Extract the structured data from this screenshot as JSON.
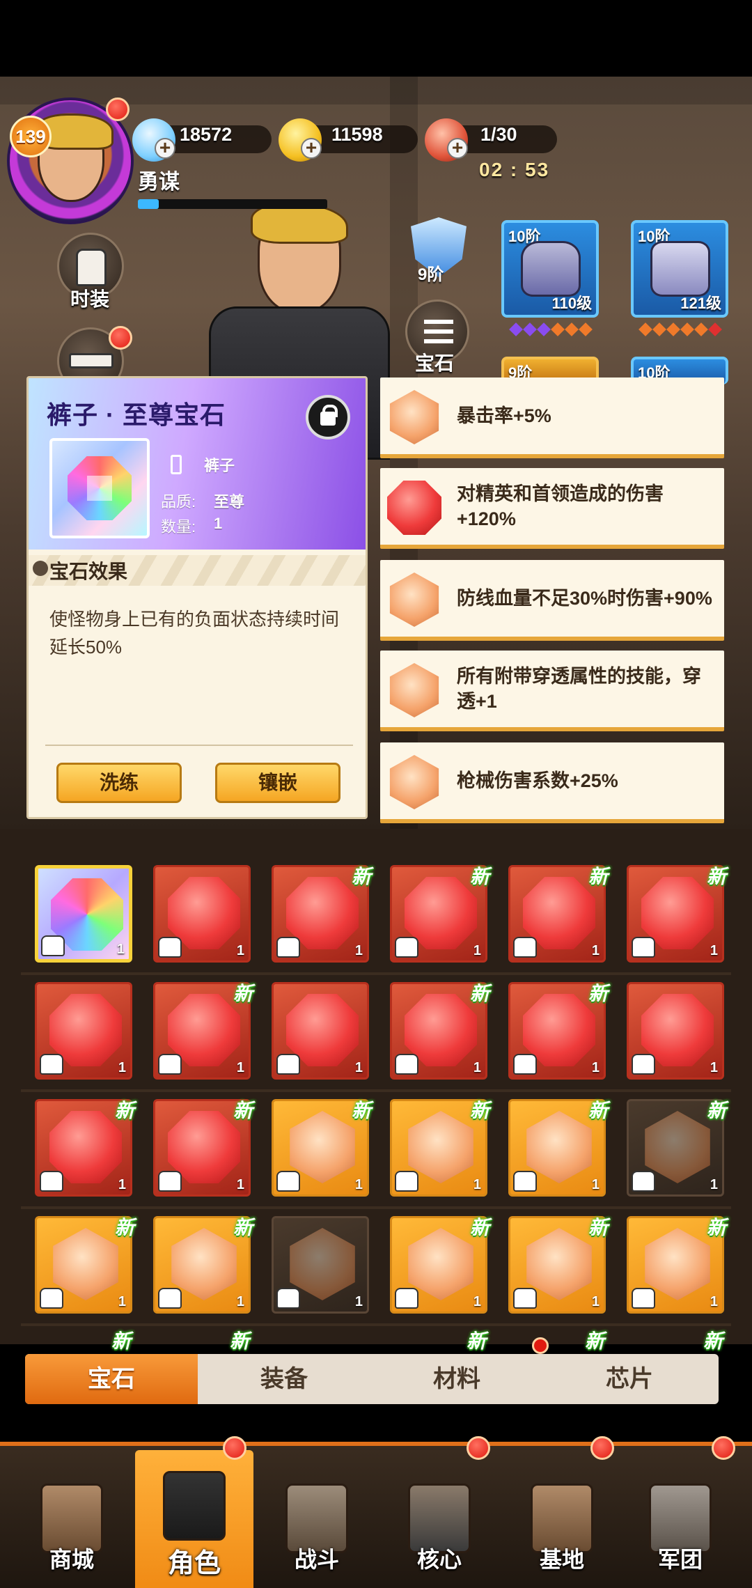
{
  "player": {
    "level": "139",
    "name": "勇谋",
    "timer": "02 : 53"
  },
  "resources": {
    "diamonds": "18572",
    "coins": "11598",
    "stamina": "1/30"
  },
  "side_buttons": {
    "costume": "时装"
  },
  "hero_panel": {
    "armor_tier": "9阶",
    "gem_button": "宝石",
    "equipment": [
      {
        "tier": "10阶",
        "level": "110级",
        "gem_colors": [
          "#8a4cf0",
          "#8a4cf0",
          "#8a4cf0",
          "#f07a2a",
          "#f07a2a",
          "#f07a2a"
        ]
      },
      {
        "tier": "10阶",
        "level": "121级",
        "gem_colors": [
          "#f07a2a",
          "#f07a2a",
          "#f07a2a",
          "#f07a2a",
          "#f07a2a",
          "#e03030"
        ]
      },
      {
        "tier": "9阶"
      },
      {
        "tier": "10阶"
      }
    ]
  },
  "gem_detail": {
    "title": "裤子 · 至尊宝石",
    "slot": "裤子",
    "quality_label": "品质:",
    "quality_value": "至尊",
    "quantity_label": "数量:",
    "quantity_value": "1",
    "effect_title": "宝石效果",
    "effect_desc": "使怪物身上已有的负面状态持续时间延长50%",
    "refine_button": "洗练",
    "inlay_button": "镶嵌"
  },
  "attributes": [
    {
      "text": "暴击率+5%",
      "color": "orange"
    },
    {
      "text": "对精英和首领造成的伤害+120%",
      "color": "red"
    },
    {
      "text": "防线血量不足30%时伤害+90%",
      "color": "orange"
    },
    {
      "text": "所有附带穿透属性的技能，穿透+1",
      "color": "orange"
    },
    {
      "text": "枪械伤害系数+25%",
      "color": "orange"
    }
  ],
  "inventory": {
    "new_label": "新",
    "items": [
      {
        "kind": "rainbow",
        "count": "1",
        "new": false
      },
      {
        "kind": "red",
        "count": "1",
        "new": false
      },
      {
        "kind": "red",
        "count": "1",
        "new": true
      },
      {
        "kind": "red",
        "count": "1",
        "new": true
      },
      {
        "kind": "red",
        "count": "1",
        "new": true
      },
      {
        "kind": "red",
        "count": "1",
        "new": true
      },
      {
        "kind": "red",
        "count": "1",
        "new": false
      },
      {
        "kind": "red",
        "count": "1",
        "new": true
      },
      {
        "kind": "red",
        "count": "1",
        "new": false
      },
      {
        "kind": "red",
        "count": "1",
        "new": true
      },
      {
        "kind": "red",
        "count": "1",
        "new": true
      },
      {
        "kind": "red",
        "count": "1",
        "new": false
      },
      {
        "kind": "red",
        "count": "1",
        "new": true
      },
      {
        "kind": "red",
        "count": "1",
        "new": true
      },
      {
        "kind": "orange",
        "count": "1",
        "new": true
      },
      {
        "kind": "orange",
        "count": "1",
        "new": true
      },
      {
        "kind": "orange",
        "count": "1",
        "new": true
      },
      {
        "kind": "dark",
        "count": "1",
        "new": true
      },
      {
        "kind": "orange",
        "count": "1",
        "new": true
      },
      {
        "kind": "orange",
        "count": "1",
        "new": true
      },
      {
        "kind": "dark",
        "count": "1",
        "new": false
      },
      {
        "kind": "orange",
        "count": "1",
        "new": true
      },
      {
        "kind": "orange",
        "count": "1",
        "new": true
      },
      {
        "kind": "orange",
        "count": "1",
        "new": true
      }
    ],
    "partial_row_new": [
      true,
      true,
      false,
      true,
      true,
      true
    ]
  },
  "tabs": [
    "宝石",
    "装备",
    "材料",
    "芯片"
  ],
  "nav": [
    "商城",
    "角色",
    "战斗",
    "核心",
    "基地",
    "军团"
  ]
}
